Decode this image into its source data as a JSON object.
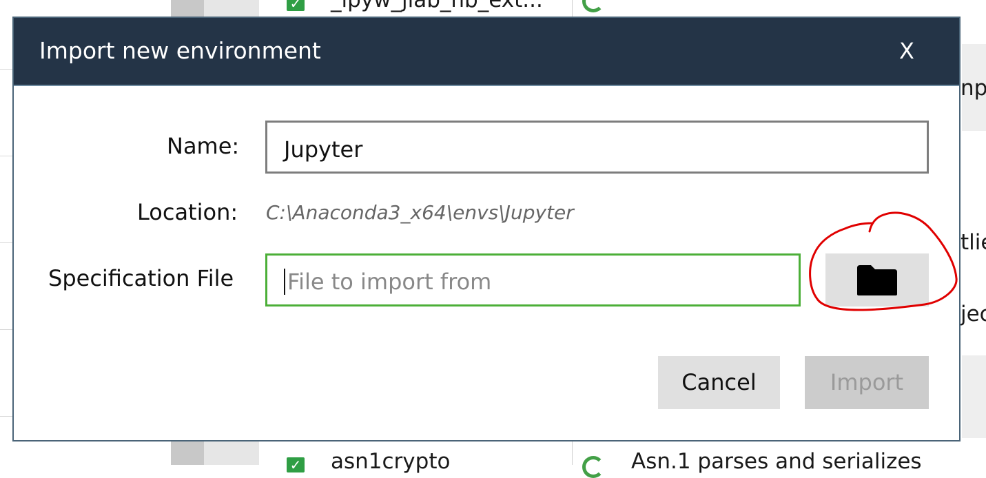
{
  "background": {
    "top_row": {
      "checked": true,
      "name": "_ipyw_jlab_nb_ext..."
    },
    "bottom_row": {
      "checked": true,
      "name": "asn1crypto",
      "description": "Asn.1 parses and serializes"
    },
    "right_fragments": [
      "npa",
      "tlie",
      "jec"
    ]
  },
  "dialog": {
    "title": "Import new environment",
    "close_label": "X",
    "name_label": "Name:",
    "name_value": "Jupyter",
    "location_label": "Location:",
    "location_value": "C:\\Anaconda3_x64\\envs\\Jupyter",
    "spec_label": "Specification File",
    "spec_placeholder": "File to import from",
    "spec_value": "",
    "browse_icon": "folder-icon",
    "cancel_label": "Cancel",
    "import_label": "Import",
    "import_enabled": false
  },
  "colors": {
    "titlebar": "#243447",
    "spec_border_focus": "#4caf38",
    "annotation": "#e00000"
  }
}
